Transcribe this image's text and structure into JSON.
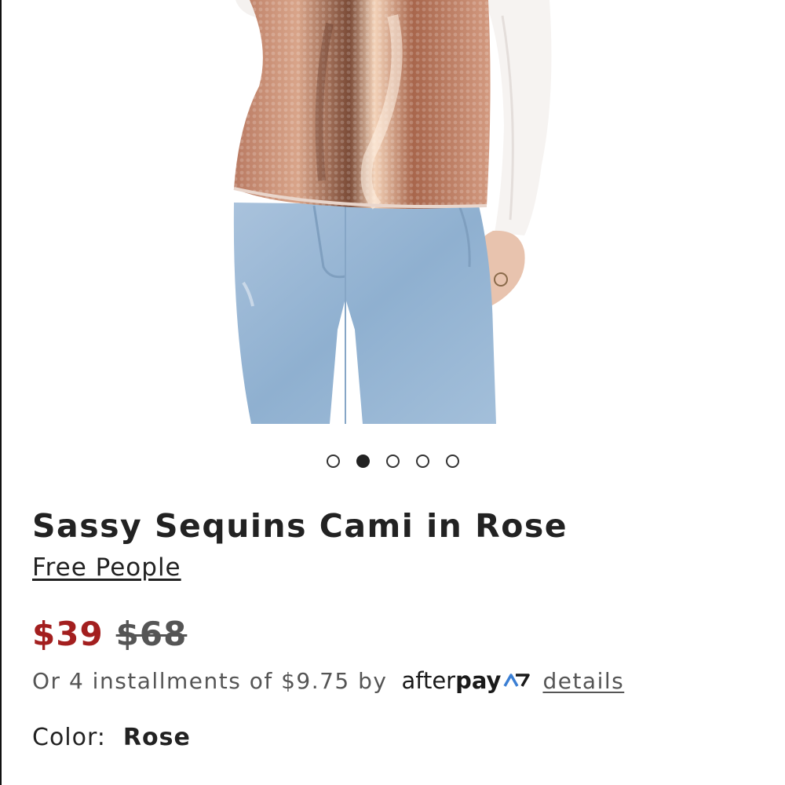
{
  "gallery": {
    "image_alt": "Product photo: model wearing rose sequin cami with light wash jeans",
    "dot_count": 5,
    "active_dot_index": 1
  },
  "product": {
    "title": "Sassy Sequins Cami in Rose",
    "brand": "Free People"
  },
  "pricing": {
    "sale_price": "$39",
    "original_price": "$68",
    "installments_text": "Or 4 installments of $9.75 by",
    "afterpay_after": "after",
    "afterpay_pay": "pay",
    "details_label": "details"
  },
  "color": {
    "label": "Color:",
    "value": "Rose"
  },
  "colors": {
    "sale_red": "#a31f1f",
    "text_dark": "#222222",
    "text_muted": "#555555",
    "sequin_rose": "#c98a6e",
    "denim_blue": "#9bb7d4"
  }
}
